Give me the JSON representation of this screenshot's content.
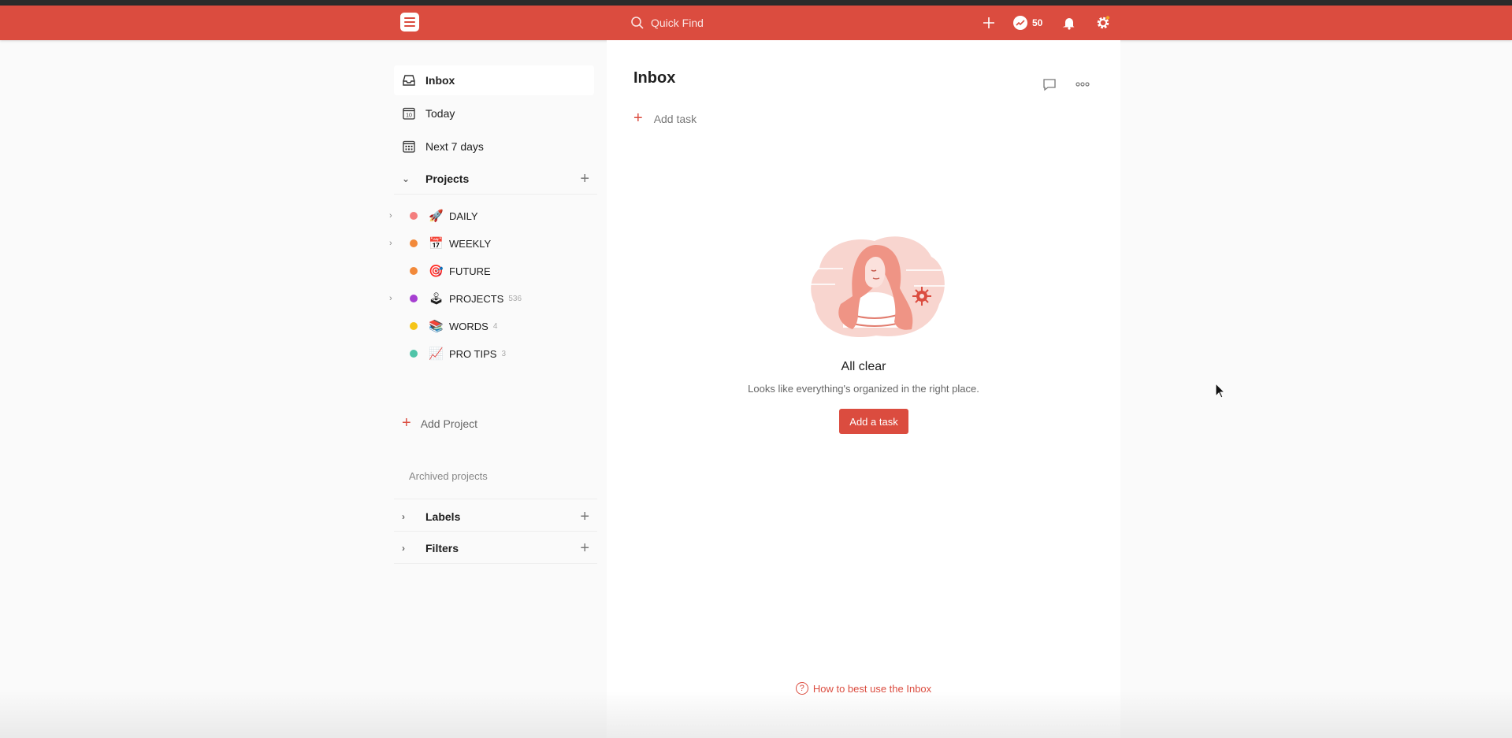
{
  "topbar": {
    "search_placeholder": "Quick Find",
    "karma": "50",
    "icons": [
      "todoist-logo-icon",
      "search-icon",
      "plus-icon",
      "karma-icon",
      "bell-icon",
      "gear-icon"
    ]
  },
  "sidebar": {
    "nav": [
      {
        "label": "Inbox",
        "icon": "inbox-icon"
      },
      {
        "label": "Today",
        "icon": "calendar-day-icon",
        "day": "10"
      },
      {
        "label": "Next 7 days",
        "icon": "calendar-grid-icon"
      }
    ],
    "projects_header": "Projects",
    "projects": [
      {
        "name": "DAILY",
        "emoji": "🚀",
        "count": "",
        "color": "#f47e7e"
      },
      {
        "name": "WEEKLY",
        "emoji": "📅",
        "count": "",
        "color": "#f2893a"
      },
      {
        "name": "FUTURE",
        "emoji": "🎯",
        "count": "",
        "color": "#f2893a"
      },
      {
        "name": "PROJECTS",
        "emoji": "🕹",
        "count": "536",
        "color": "#a63fd1"
      },
      {
        "name": "WORDS",
        "emoji": "📚",
        "count": "4",
        "color": "#f5c518"
      },
      {
        "name": "PRO TIPS",
        "emoji": "📈",
        "count": "3",
        "color": "#4fc4a8"
      }
    ],
    "add_project": "Add Project",
    "archived": "Archived projects",
    "labels_header": "Labels",
    "filters_header": "Filters"
  },
  "main": {
    "title": "Inbox",
    "add_task": "Add task",
    "empty_title": "All clear",
    "empty_subtitle": "Looks like everything's organized in the right place.",
    "add_task_button": "Add a task",
    "help_link": "How to best use the Inbox",
    "help_icon_glyph": "?"
  },
  "colors": {
    "brand": "#db4c3f"
  }
}
